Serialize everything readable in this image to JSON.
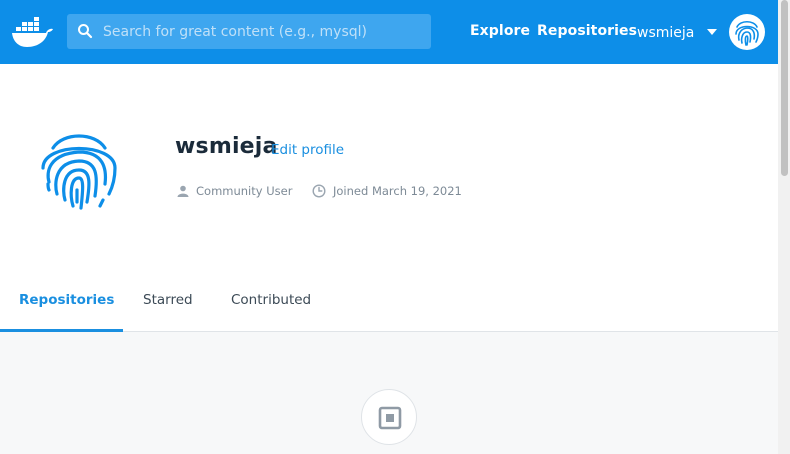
{
  "header": {
    "logo_icon": "docker-whale-icon",
    "search": {
      "placeholder": "Search for great content (e.g., mysql)",
      "value": ""
    },
    "nav": {
      "explore": "Explore",
      "repositories": "Repositories"
    },
    "user_menu": {
      "username": "wsmieja",
      "avatar_icon": "fingerprint-icon"
    }
  },
  "profile": {
    "username": "wsmieja",
    "edit_profile": "Edit profile",
    "role": "Community User",
    "joined": "Joined March 19, 2021",
    "avatar_icon": "fingerprint-icon"
  },
  "tabs": [
    {
      "label": "Repositories",
      "active": true
    },
    {
      "label": "Starred",
      "active": false
    },
    {
      "label": "Contributed",
      "active": false
    }
  ],
  "colors": {
    "brand": "#0d8ee8",
    "accent": "#1a8fe0",
    "text": "#1b2b3a",
    "muted": "#7d8a96"
  }
}
